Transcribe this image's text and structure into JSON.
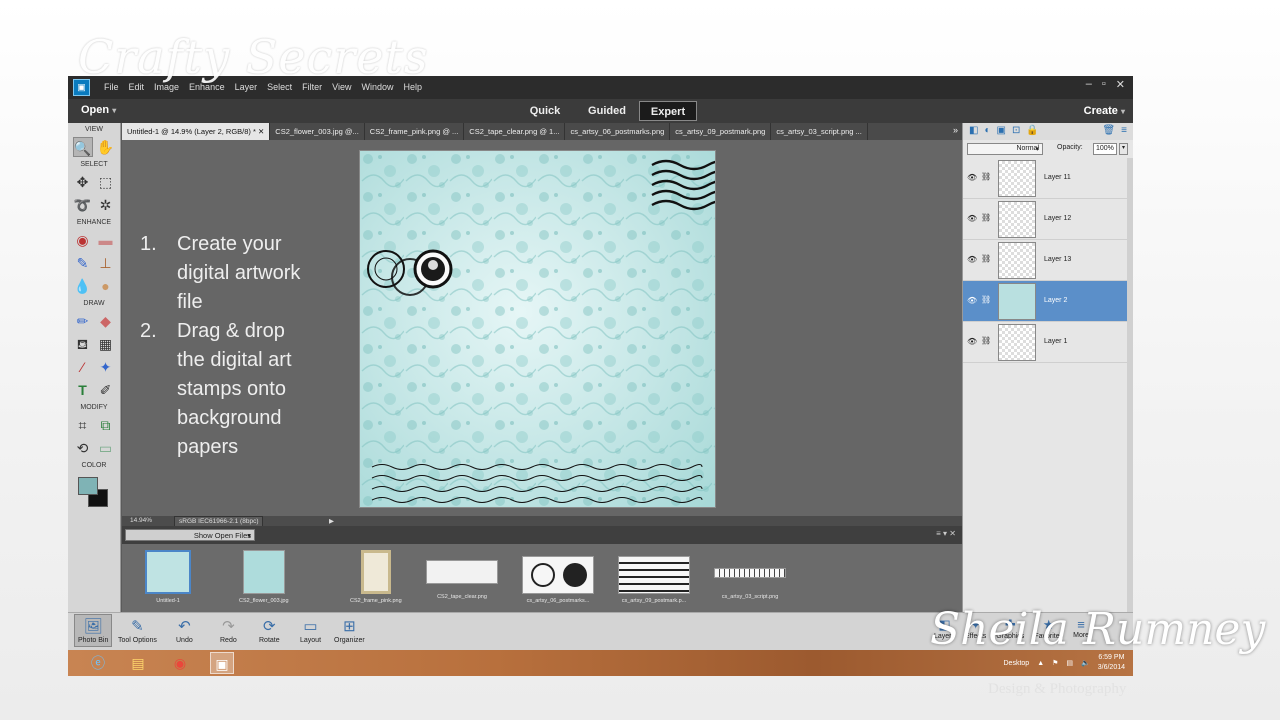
{
  "branding": {
    "top_script": "Crafty Secrets",
    "signature": "Sheila Rumney",
    "subtitle": "Design  & Photography"
  },
  "menubar": {
    "app_icon": "pse-app-icon",
    "items": [
      "File",
      "Edit",
      "Image",
      "Enhance",
      "Layer",
      "Select",
      "Filter",
      "View",
      "Window",
      "Help"
    ],
    "window_controls": [
      "–",
      "▫",
      "✕"
    ]
  },
  "modebar": {
    "open_label": "Open",
    "modes": [
      "Quick",
      "Guided",
      "Expert"
    ],
    "active_mode": "Expert",
    "create_label": "Create"
  },
  "toolbox": {
    "sections": {
      "view": "VIEW",
      "select": "SELECT",
      "enhance": "ENHANCE",
      "draw": "DRAW",
      "modify": "MODIFY",
      "color": "COLOR"
    },
    "foreground_color": "#7fb3b5",
    "background_color": "#111111"
  },
  "doc_tabs": [
    "Untitled-1 @ 14.9% (Layer 2, RGB/8) *",
    "CS2_flower_003.jpg @...",
    "CS2_frame_pink.png @ ...",
    "CS2_tape_clear.png @ 1...",
    "cs_artsy_06_postmarks.png",
    "cs_artsy_09_postmark.png",
    "cs_artsy_03_script.png ..."
  ],
  "tab_more": "»",
  "instructions": [
    {
      "num": "1.",
      "lines": [
        "Create your",
        "digital artwork",
        "file"
      ]
    },
    {
      "num": "2.",
      "lines": [
        "Drag & drop",
        "the digital art",
        "stamps onto",
        "background",
        "papers"
      ]
    }
  ],
  "status": {
    "zoom": "14.94%",
    "profile": "sRGB IEC61966-2.1 (8bpc)",
    "arrow": "▶"
  },
  "photo_bin": {
    "dropdown": "Show Open Files",
    "menu_icon": "≡",
    "files": [
      "Untitled-1",
      "CS2_flower_003.jpg",
      "CS2_frame_pink.png",
      "CS2_tape_clear.png",
      "cs_artsy_06_postmarks...",
      "cs_artsy_09_postmark.p...",
      "cs_artsy_03_script.png"
    ]
  },
  "layers_panel": {
    "blend_mode": "Normal",
    "opacity_label": "Opacity:",
    "opacity_value": "100%",
    "layers": [
      "Layer 11",
      "Layer 12",
      "Layer 13",
      "Layer 2",
      "Layer 1"
    ],
    "selected_layer": "Layer 2",
    "selection_color": "#5b8fc9"
  },
  "bottom_toolbar": {
    "items": [
      "Photo Bin",
      "Tool Options",
      "Undo",
      "Redo",
      "Rotate",
      "Layout",
      "Organizer"
    ],
    "right_items": [
      "Layers",
      "Effects",
      "Graphics",
      "Favorites",
      "More"
    ]
  },
  "taskbar": {
    "desktop_label": "Desktop",
    "time": "6:59 PM",
    "date": "3/6/2014"
  }
}
